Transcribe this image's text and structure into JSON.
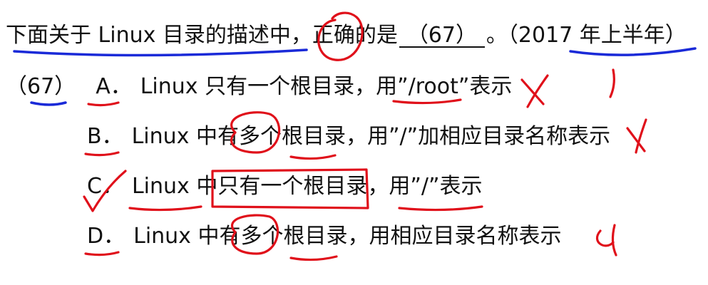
{
  "question": {
    "prefix": "下面关于 Linux 目录的描述中，正确的是",
    "blank": "（67）",
    "suffix": "。（2017 年上半年）"
  },
  "question_number": "（67）",
  "options": [
    {
      "letter": "A．",
      "text": "Linux 只有一个根目录，用”/root”表示"
    },
    {
      "letter": "B．",
      "text": "Linux 中有多个根目录，用”/”加相应目录名称表示"
    },
    {
      "letter": "C．",
      "text": "Linux 中只有一个根目录，用”/”表示"
    },
    {
      "letter": "D．",
      "text": "Linux 中有多个根目录，用相应目录名称表示"
    }
  ],
  "annotation_colors": {
    "blue": "#1a2ad8",
    "red": "#e0101a"
  }
}
